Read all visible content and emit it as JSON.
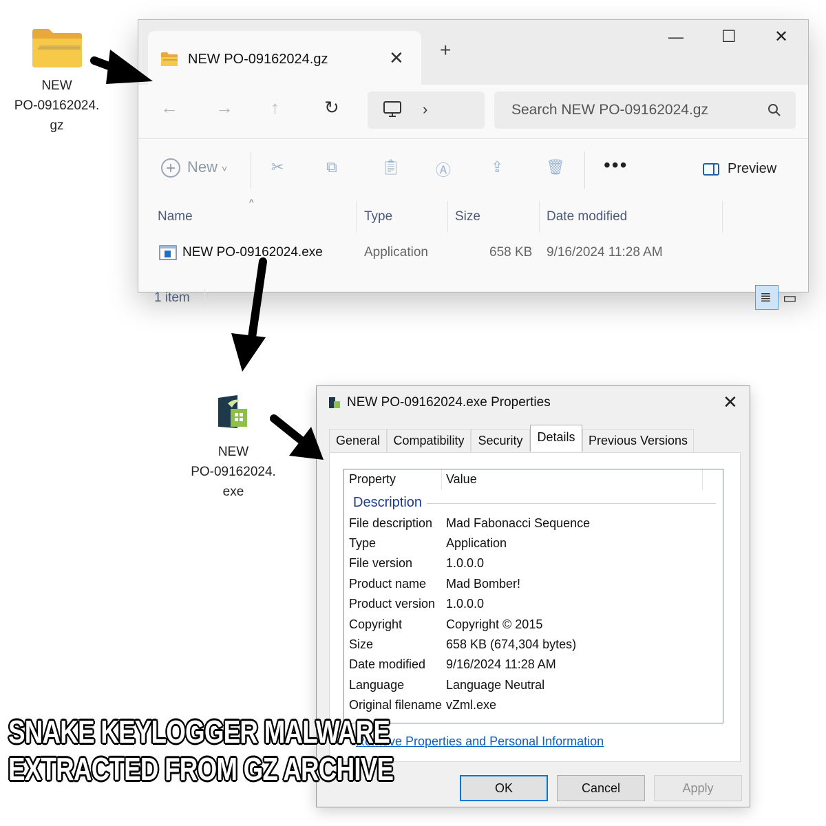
{
  "desktop": {
    "archive_icon_label": "NEW\nPO-09162024.\ngz",
    "exe_icon_label": "NEW\nPO-09162024.\nexe"
  },
  "explorer": {
    "tab_title": "NEW PO-09162024.gz",
    "search_placeholder": "Search NEW PO-09162024.gz",
    "toolbar": {
      "new_label": "New",
      "preview_label": "Preview"
    },
    "columns": [
      "Name",
      "Type",
      "Size",
      "Date modified"
    ],
    "rows": [
      {
        "name": "NEW PO-09162024.exe",
        "type": "Application",
        "size": "658 KB",
        "date": "9/16/2024 11:28 AM"
      }
    ],
    "status": "1 item"
  },
  "properties": {
    "title": "NEW PO-09162024.exe Properties",
    "tabs": [
      "General",
      "Compatibility",
      "Security",
      "Details",
      "Previous Versions"
    ],
    "active_tab": "Details",
    "header": {
      "property": "Property",
      "value": "Value"
    },
    "section": "Description",
    "rows": [
      {
        "name": "File description",
        "value": "Mad Fabonacci Sequence"
      },
      {
        "name": "Type",
        "value": "Application"
      },
      {
        "name": "File version",
        "value": "1.0.0.0"
      },
      {
        "name": "Product name",
        "value": "Mad Bomber!"
      },
      {
        "name": "Product version",
        "value": "1.0.0.0"
      },
      {
        "name": "Copyright",
        "value": "Copyright ©  2015"
      },
      {
        "name": "Size",
        "value": "658 KB (674,304 bytes)"
      },
      {
        "name": "Date modified",
        "value": "9/16/2024 11:28 AM"
      },
      {
        "name": "Language",
        "value": "Language Neutral"
      },
      {
        "name": "Original filename",
        "value": "vZml.exe"
      }
    ],
    "link": "Remove Properties and Personal Information",
    "buttons": {
      "ok": "OK",
      "cancel": "Cancel",
      "apply": "Apply"
    }
  },
  "caption": {
    "line1": "SNAKE  KEYLOGGER  MALWARE",
    "line2": "EXTRACTED  FROM  GZ  ARCHIVE"
  }
}
